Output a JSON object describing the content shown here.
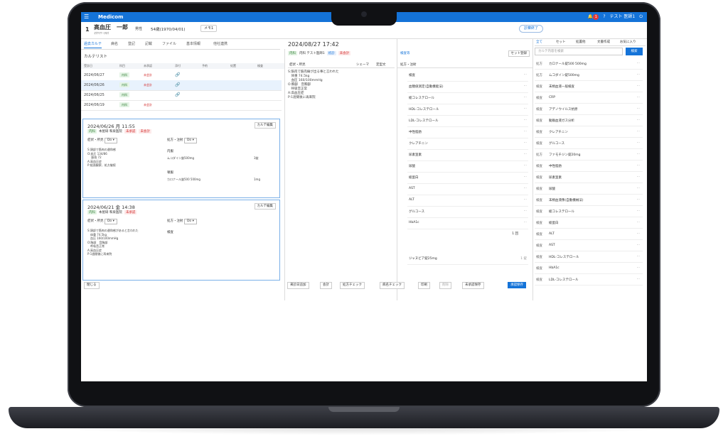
{
  "app": {
    "name": "Medicom",
    "user": "テスト 医師1"
  },
  "patient": {
    "number": "1",
    "name": "高血圧　一郎",
    "kana": "ｺｳｹﾂｱﾂ ｲﾁﾛｳ",
    "gender": "男性",
    "age": "54歳(1970/04/01)",
    "memo": "メモ1",
    "end_button": "診察終了"
  },
  "tabs": [
    "過去カルテ",
    "病名",
    "登記",
    "記載",
    "ファイル",
    "基本情報",
    "他社連携"
  ],
  "karte_list": {
    "title": "カルテリスト",
    "rows": [
      {
        "date": "2024/06/27",
        "tag": "内科",
        "status": "未会計"
      },
      {
        "date": "2024/06/26",
        "tag": "内科",
        "status": "未会計"
      },
      {
        "date": "2024/06/25",
        "tag": "内科",
        "status": ""
      },
      {
        "date": "2024/06/19",
        "tag": "内科",
        "status": "未会計"
      }
    ]
  },
  "card1": {
    "date": "2024/06/26 月 11:55",
    "edit": "カルテ編集",
    "note": "S:頭部で筋肉の違和感\nO:血圧 134/86\n　 脈拍 72\nA:高血圧症\nP:経過観察、処方継続",
    "rx1": "ムコダイン錠500mg",
    "rx1q": "3錠",
    "rx2": "カロナール錠500 500mg",
    "rx2q": "1mg"
  },
  "card2": {
    "date": "2024/06/21 金 14:38",
    "edit": "カルテ編集",
    "note": "S:頭部で筋肉の違和感があると言われた\n　体重 74.5kg\n　血圧 160/100mmHg\nO:胸部　音胸部\n　呼吸音正常\nA:高血圧症\nP:1週間後に再来院",
    "lab": "検査"
  },
  "mid": {
    "datetime": "2024/08/27 17:42",
    "soap": "S:筋肉で筋肉痛が出る事と言われた\n　体重 74.5kg\n　血圧 160/100mmHg\nO:胸部　音胸部\n　呼吸音正常\nA:高血圧症\nP:1週間後に再来院"
  },
  "rx": {
    "head": "検査等",
    "set_button": "セット登録",
    "items": [
      "検査",
      "血糖値測定(自動機能法)",
      "総コレステロール",
      "HDL-コレステロール",
      "LDL-コレステロール",
      "中性脂肪",
      "クレアチニン",
      "尿素窒素",
      "尿酸",
      "総蛋白",
      "AST",
      "ALT",
      "グルコース",
      "HbA1c"
    ],
    "qty": "1 回",
    "drug": "ジャヌビア錠25mg",
    "drugqty": "1 錠"
  },
  "right": {
    "tabs": [
      "全て",
      "セット",
      "処置他",
      "文書作成",
      "お気に入り"
    ],
    "search_placeholder": "カルテ内容を検索",
    "search_button": "検索",
    "items": [
      {
        "k": "処方",
        "n": "カロナール錠500 500mg"
      },
      {
        "k": "処方",
        "n": "ムコダイン錠500mg"
      },
      {
        "k": "検査",
        "n": "末梢血液一般検査"
      },
      {
        "k": "検査",
        "n": "CRP"
      },
      {
        "k": "検査",
        "n": "アデノウイルス抗原"
      },
      {
        "k": "検査",
        "n": "動脈血液ガス分析"
      },
      {
        "k": "検査",
        "n": "クレアチニン"
      },
      {
        "k": "検査",
        "n": "グルコース"
      },
      {
        "k": "処方",
        "n": "ファモチジン錠20mg"
      },
      {
        "k": "検査",
        "n": "中性脂肪"
      },
      {
        "k": "検査",
        "n": "尿素窒素"
      },
      {
        "k": "検査",
        "n": "尿酸"
      },
      {
        "k": "検査",
        "n": "末梢血液像(自動機械法)"
      },
      {
        "k": "検査",
        "n": "総コレステロール"
      },
      {
        "k": "検査",
        "n": "総蛋白"
      },
      {
        "k": "検査",
        "n": "ALT"
      },
      {
        "k": "検査",
        "n": "AST"
      },
      {
        "k": "検査",
        "n": "HDL-コレステロール"
      },
      {
        "k": "検査",
        "n": "HbA1c"
      },
      {
        "k": "検査",
        "n": "LDL-コレステロール"
      }
    ]
  },
  "bottom": {
    "close": "閉じる",
    "reserve": "来診日追加",
    "bill": "会計",
    "check": "処方チェック",
    "disease": "病名チェック",
    "print": "印刷",
    "delete": "削除",
    "unsaved": "未承認保存",
    "save": "承認保存"
  }
}
